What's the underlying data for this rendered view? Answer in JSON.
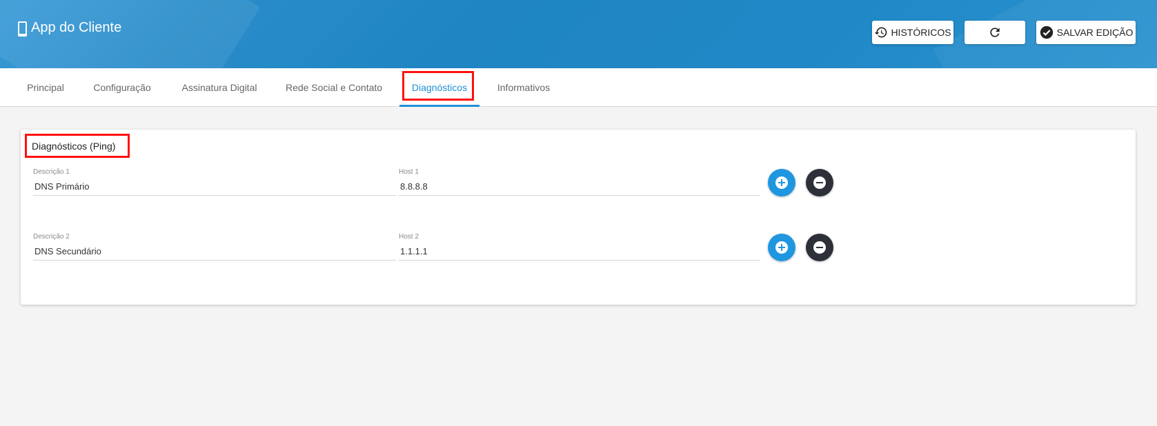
{
  "header": {
    "app_title": "App do Cliente",
    "buttons": {
      "history_label": "HISTÓRICOS",
      "save_label": "SALVAR EDIÇÃO"
    }
  },
  "tabs": [
    {
      "label": "Principal"
    },
    {
      "label": "Configuração"
    },
    {
      "label": "Assinatura Digital"
    },
    {
      "label": "Rede Social e Contato"
    },
    {
      "label": "Diagnósticos"
    },
    {
      "label": "Informativos"
    }
  ],
  "active_tab": "Diagnósticos",
  "card": {
    "title": "Diagnósticos (Ping)",
    "rows": [
      {
        "desc_label": "Descrição 1",
        "desc_value": "DNS Primário",
        "host_label": "Host 1",
        "host_value": "8.8.8.8"
      },
      {
        "desc_label": "Descrição 2",
        "desc_value": "DNS Secundário",
        "host_label": "Host 2",
        "host_value": "1.1.1.1"
      }
    ]
  },
  "colors": {
    "header_bg": "#2088c6",
    "accent": "#1f8fd6",
    "highlight": "#ff1010",
    "remove_button": "#2d3038"
  },
  "icons": {
    "app": "phone-icon",
    "history": "history-icon",
    "refresh": "refresh-icon",
    "save": "check-circle-icon",
    "add": "plus-circle-icon",
    "remove": "minus-circle-icon"
  }
}
